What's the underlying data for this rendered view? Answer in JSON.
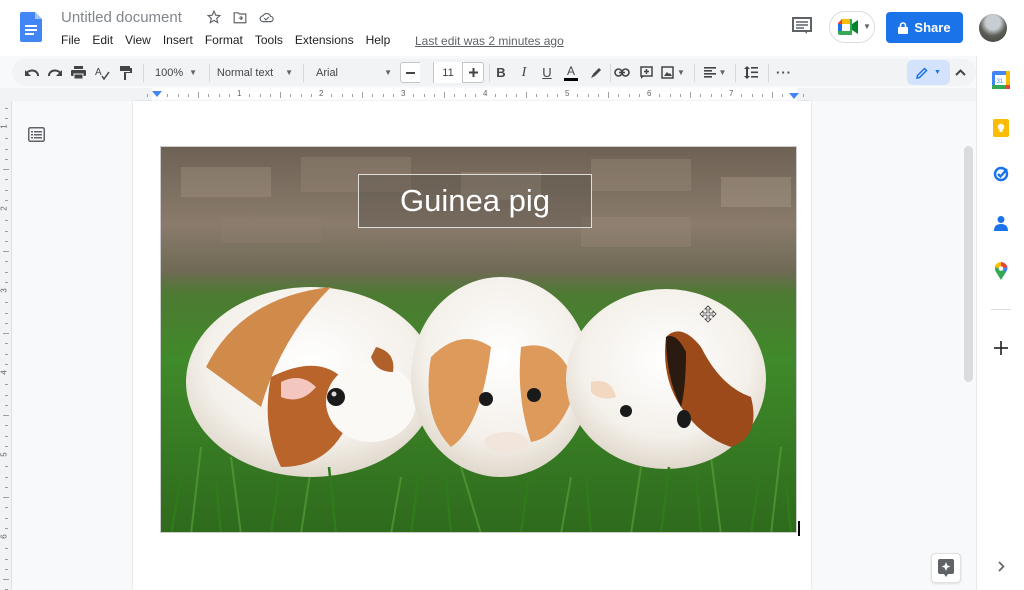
{
  "app": {
    "document_title": "Untitled document",
    "last_edit": "Last edit was 2 minutes ago"
  },
  "menu": {
    "items": [
      "File",
      "Edit",
      "View",
      "Insert",
      "Format",
      "Tools",
      "Extensions",
      "Help"
    ]
  },
  "header": {
    "share_label": "Share",
    "icons": [
      "star-icon",
      "move-to-folder-icon",
      "cloud-saved-icon",
      "comment-history-icon",
      "meet-icon",
      "lock-icon",
      "avatar"
    ]
  },
  "toolbar": {
    "zoom": "100%",
    "style": "Normal text",
    "font": "Arial",
    "font_size": "11",
    "text_color": "#000000",
    "edit_mode_color": "#1a73e8"
  },
  "ruler": {
    "horizontal_numbers": [
      "1",
      "2",
      "3",
      "4",
      "5",
      "6",
      "7"
    ],
    "vertical_numbers": [
      "1",
      "2",
      "3",
      "4",
      "5",
      "6"
    ]
  },
  "document": {
    "caption": "Guinea pig",
    "image_description": "Three guinea pigs on grass"
  },
  "side_panel": {
    "calendar_day": "31",
    "items": [
      "calendar",
      "keep",
      "tasks",
      "contacts",
      "maps"
    ]
  },
  "colors": {
    "accent": "#1a73e8",
    "docs_blue": "#4285f4"
  }
}
